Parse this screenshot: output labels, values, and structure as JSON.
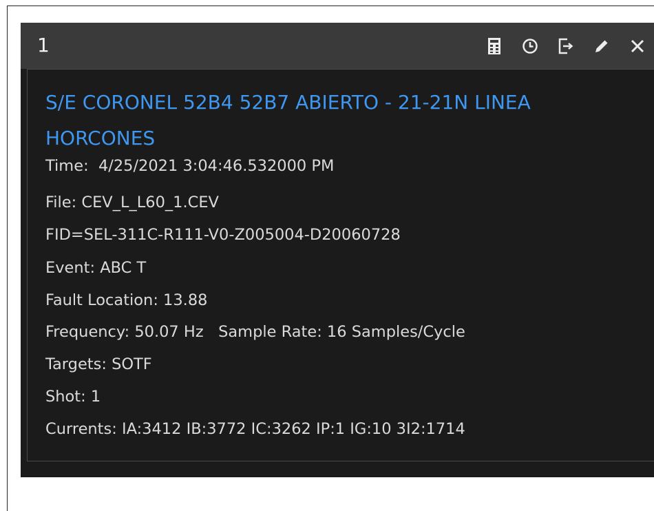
{
  "panel": {
    "number": "1",
    "toolbar": [
      {
        "name": "calculator-icon"
      },
      {
        "name": "clock-icon"
      },
      {
        "name": "export-icon"
      },
      {
        "name": "pencil-icon"
      },
      {
        "name": "close-icon"
      }
    ]
  },
  "event": {
    "title": "S/E CORONEL 52B4 52B7 ABIERTO - 21-21N LINEA HORCONES",
    "time": "Time:  4/25/2021 3:04:46.532000 PM",
    "file": "File: CEV_L_L60_1.CEV",
    "fid": "FID=SEL-311C-R111-V0-Z005004-D20060728",
    "event_type": "Event: ABC T",
    "fault_location": "Fault Location: 13.88",
    "frequency": "Frequency: 50.07 Hz   Sample Rate: 16 Samples/Cycle",
    "targets": "Targets: SOTF",
    "shot": "Shot: 1",
    "currents": "Currents: IA:3412 IB:3772 IC:3262 IP:1 IG:10 3I2:1714"
  },
  "colors": {
    "title_text": "#3f97f0",
    "body_text": "#dadada",
    "panel_bg": "#1b1b1b",
    "titlebar_bg": "#3a3a3a"
  }
}
